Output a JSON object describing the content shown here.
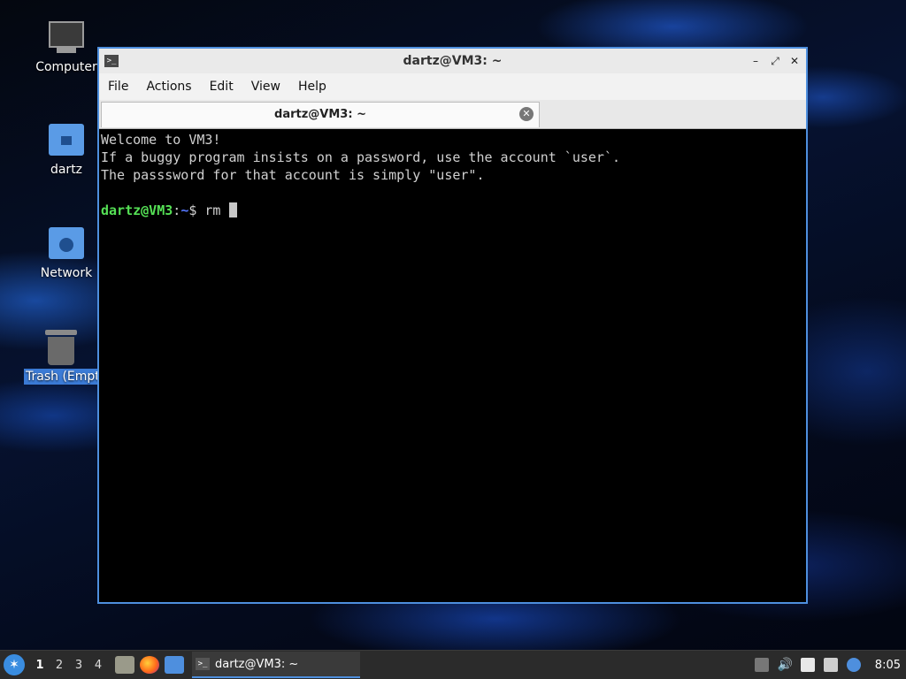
{
  "desktop": {
    "icons": [
      {
        "label": "Computer"
      },
      {
        "label": "dartz"
      },
      {
        "label": "Network"
      },
      {
        "label": "Trash (Empty)"
      }
    ]
  },
  "window": {
    "title": "dartz@VM3: ~",
    "menu": [
      "File",
      "Actions",
      "Edit",
      "View",
      "Help"
    ],
    "tab_label": "dartz@VM3: ~",
    "terminal": {
      "lines": [
        "Welcome to VM3!",
        "If a buggy program insists on a password, use the account `user`.",
        "The passsword for that account is simply \"user\"."
      ],
      "prompt_user": "dartz@VM3",
      "prompt_sep": ":",
      "prompt_path": "~",
      "prompt_symbol": "$",
      "command": "rm"
    }
  },
  "taskbar": {
    "workspaces": [
      "1",
      "2",
      "3",
      "4"
    ],
    "active_workspace": "1",
    "task_label": "dartz@VM3: ~",
    "clock": "8:05"
  },
  "colors": {
    "accent": "#4e8fde",
    "prompt_user": "#55e055",
    "prompt_path": "#5577ff"
  }
}
